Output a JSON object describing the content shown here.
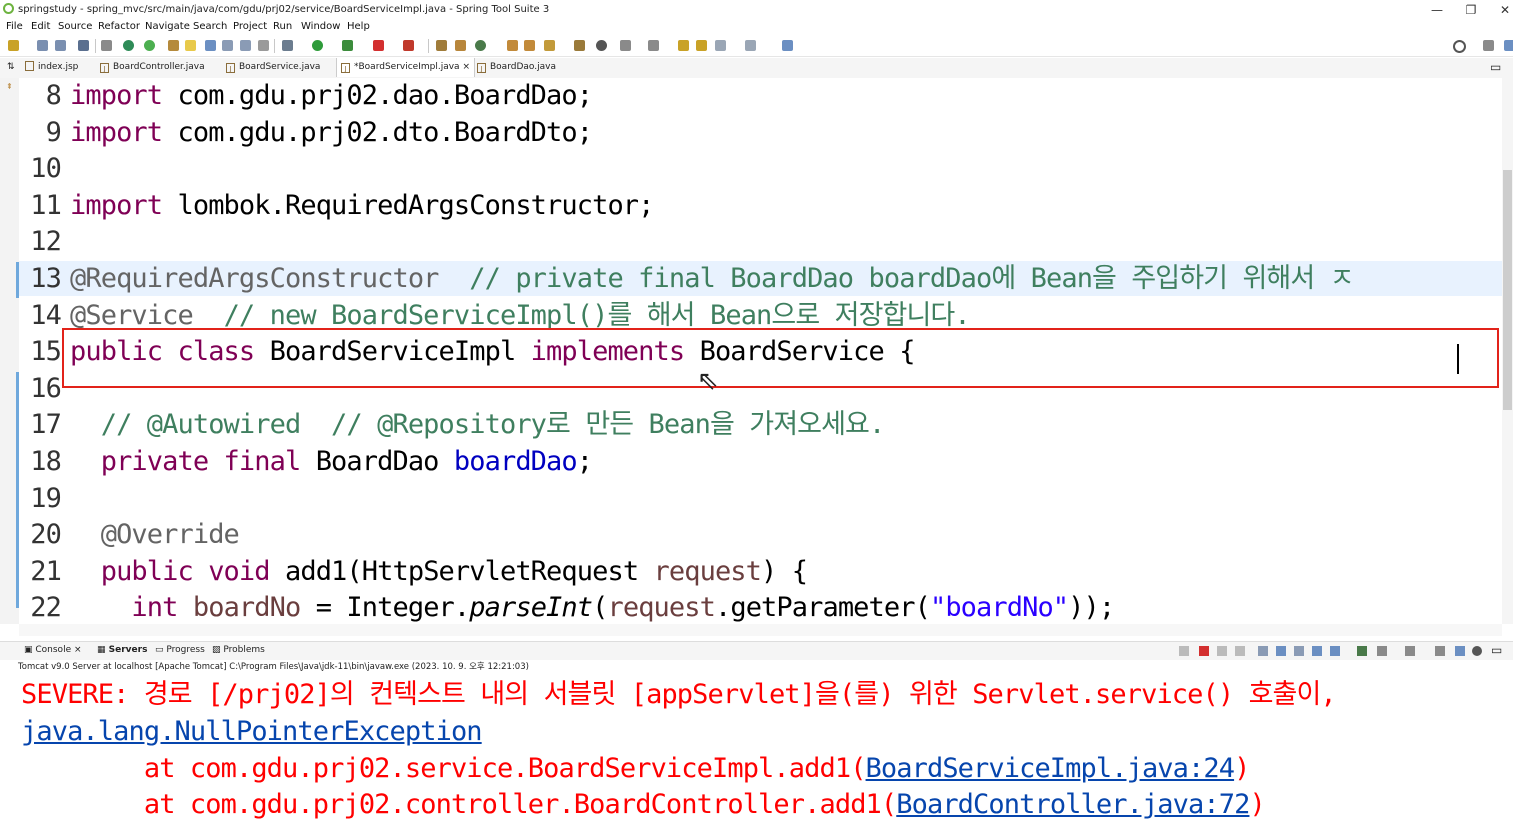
{
  "window": {
    "title": "springstudy - spring_mvc/src/main/java/com/gdu/prj02/service/BoardServiceImpl.java - Spring Tool Suite 3",
    "minimize": "—",
    "maximize": "❐",
    "close": "✕"
  },
  "menu": [
    "File",
    "Edit",
    "Source",
    "Refactor",
    "Navigate",
    "Search",
    "Project",
    "Run",
    "Window",
    "Help"
  ],
  "tabs": [
    {
      "label": "index.jsp"
    },
    {
      "label": "BoardController.java"
    },
    {
      "label": "BoardService.java"
    },
    {
      "label": "*BoardServiceImpl.java",
      "close": "×"
    },
    {
      "label": "BoardDao.java"
    }
  ],
  "editor": {
    "lines": [
      {
        "num": "8",
        "parts": [
          [
            "kw",
            "import"
          ],
          [
            "t",
            " com.gdu.prj02.dao.BoardDao;"
          ]
        ]
      },
      {
        "num": "9",
        "parts": [
          [
            "kw",
            "import"
          ],
          [
            "t",
            " com.gdu.prj02.dto.BoardDto;"
          ]
        ]
      },
      {
        "num": "10",
        "parts": []
      },
      {
        "num": "11",
        "parts": [
          [
            "kw",
            "import"
          ],
          [
            "t",
            " lombok.RequiredArgsConstructor;"
          ]
        ]
      },
      {
        "num": "12",
        "parts": []
      },
      {
        "num": "13",
        "parts": [
          [
            "an",
            "@RequiredArgsConstructor"
          ],
          [
            "t",
            "  "
          ],
          [
            "cm",
            "// private final BoardDao boardDao에 Bean을 주입하기 위해서 ㅈ"
          ]
        ]
      },
      {
        "num": "14",
        "parts": [
          [
            "an",
            "@Service"
          ],
          [
            "t",
            "  "
          ],
          [
            "cm",
            "// new BoardServiceImpl()를 해서 Bean으로 저장합니다."
          ]
        ]
      },
      {
        "num": "15",
        "parts": [
          [
            "kw",
            "public class"
          ],
          [
            "t",
            " BoardServiceImpl "
          ],
          [
            "kw",
            "implements"
          ],
          [
            "t",
            " BoardService {"
          ]
        ]
      },
      {
        "num": "16",
        "parts": []
      },
      {
        "num": "17",
        "parts": [
          [
            "t",
            "  "
          ],
          [
            "cm",
            "// @Autowired  // @Repository로 만든 Bean을 가져오세요."
          ]
        ]
      },
      {
        "num": "18",
        "parts": [
          [
            "t",
            "  "
          ],
          [
            "kw",
            "private final"
          ],
          [
            "t",
            " BoardDao "
          ],
          [
            "fld",
            "boardDao"
          ],
          [
            "t",
            ";"
          ]
        ]
      },
      {
        "num": "19",
        "parts": []
      },
      {
        "num": "20",
        "parts": [
          [
            "t",
            "  "
          ],
          [
            "an",
            "@Override"
          ]
        ]
      },
      {
        "num": "21",
        "parts": [
          [
            "t",
            "  "
          ],
          [
            "kw",
            "public void"
          ],
          [
            "t",
            " add1(HttpServletRequest "
          ],
          [
            "prm",
            "request"
          ],
          [
            "t",
            ") {"
          ]
        ]
      },
      {
        "num": "22",
        "parts": [
          [
            "t",
            "    "
          ],
          [
            "kw",
            "int"
          ],
          [
            "t",
            " "
          ],
          [
            "prm",
            "boardNo"
          ],
          [
            "t",
            " = Integer."
          ],
          [
            "it",
            "parseInt"
          ],
          [
            "t",
            "("
          ],
          [
            "prm",
            "request"
          ],
          [
            "t",
            ".getParameter("
          ],
          [
            "str",
            "\"boardNo\""
          ],
          [
            "t",
            "));"
          ]
        ]
      }
    ]
  },
  "console": {
    "tabs": [
      "Console",
      "Servers",
      "Progress",
      "Problems"
    ],
    "process": "Tomcat v9.0 Server at localhost [Apache Tomcat] C:\\Program Files\\Java\\jdk-11\\bin\\javaw.exe  (2023. 10. 9. 오후 12:21:03)",
    "lines": [
      {
        "parts": [
          [
            "red",
            "SEVERE: 경로 [/prj02]의 컨텍스트 내의 서블릿 [appServlet]을(를) 위한 Servlet.service() 호출이,"
          ]
        ]
      },
      {
        "parts": [
          [
            "link",
            "java.lang.NullPointerException"
          ]
        ]
      },
      {
        "parts": [
          [
            "red",
            "        at com.gdu.prj02.service.BoardServiceImpl.add1("
          ],
          [
            "link",
            "BoardServiceImpl.java:24"
          ],
          [
            "red",
            ")"
          ]
        ]
      },
      {
        "parts": [
          [
            "red",
            "        at com.gdu.prj02.controller.BoardController.add1("
          ],
          [
            "link",
            "BoardController.java:72"
          ],
          [
            "red",
            ")"
          ]
        ]
      }
    ]
  }
}
